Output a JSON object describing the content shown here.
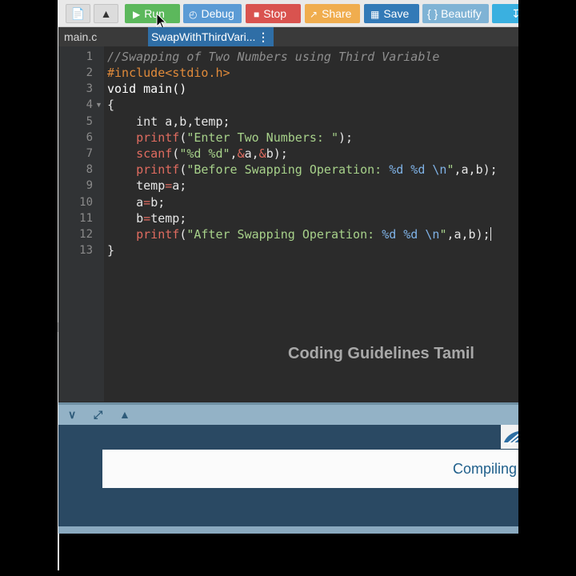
{
  "toolbar": {
    "run_label": "Run",
    "debug_label": "Debug",
    "stop_label": "Stop",
    "share_label": "Share",
    "save_label": "Save",
    "beautify_label": "{ } Beautify",
    "colors": {
      "run": "#5cb85c",
      "debug": "#5b9bd5",
      "stop": "#d9534f",
      "share": "#f0ad4e",
      "save": "#337ab7",
      "beautify": "#7fb3d5",
      "download": "#3ab0e0"
    }
  },
  "tabs": [
    {
      "label": "main.c"
    },
    {
      "label": "SwapWithThirdVari..."
    }
  ],
  "editor": {
    "line_numbers": [
      "1",
      "2",
      "3",
      "4",
      "5",
      "6",
      "7",
      "8",
      "9",
      "10",
      "11",
      "12",
      "13"
    ],
    "lines": {
      "l1": {
        "comment": "//Swapping of Two Numbers using Third Variable"
      },
      "l2": {
        "pp": "#include",
        "header": "<stdio.h>"
      },
      "l3": {
        "text": "void main()"
      },
      "l4": {
        "text": "{"
      },
      "l5": {
        "text": "    int a,b,temp;"
      },
      "l6": {
        "fn": "printf",
        "p1": "(",
        "str": "\"Enter Two Numbers: \"",
        "p2": ");"
      },
      "l7": {
        "fn": "scanf",
        "p1": "(",
        "str": "\"%d %d\"",
        "comma1": ",",
        "amp1": "&",
        "a": "a,",
        "amp2": "&",
        "b": "b);"
      },
      "l8": {
        "fn": "printf",
        "p1": "(",
        "str1": "\"Before Swapping Operation: ",
        "fmt": "%d %d \\n",
        "str2": "\"",
        "rest": ",a,b);"
      },
      "l9": {
        "v": "temp",
        "op": "=",
        "rest": "a;"
      },
      "l10": {
        "v": "a",
        "op": "=",
        "rest": "b;"
      },
      "l11": {
        "v": "b",
        "op": "=",
        "rest": "temp;"
      },
      "l12": {
        "fn": "printf",
        "p1": "(",
        "str1": "\"After Swapping Operation: ",
        "fmt": "%d %d \\n",
        "str2": "\"",
        "rest": ",a,b);"
      },
      "l13": {
        "text": "}"
      }
    }
  },
  "watermark": "Coding Guidelines Tamil",
  "output": {
    "status": "Compiling"
  },
  "icons": [
    "file-icon",
    "upload-icon",
    "play-icon",
    "debug-icon",
    "stop-icon",
    "share-icon",
    "save-icon",
    "download-icon",
    "chevron-down-icon",
    "expand-icon",
    "pin-icon",
    "kebab-menu-icon"
  ]
}
